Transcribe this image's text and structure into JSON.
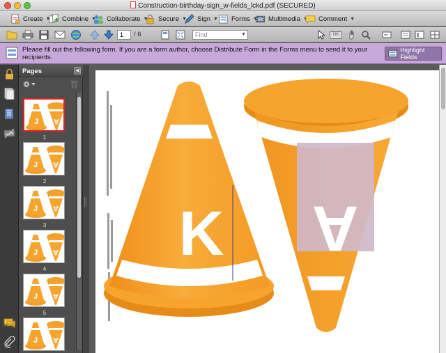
{
  "window": {
    "title": "Construction-birthday-sign_w-fields_lckd.pdf (SECURED)"
  },
  "command_bar": {
    "items": [
      {
        "label": "Create",
        "icon": "create-icon"
      },
      {
        "label": "Combine",
        "icon": "combine-icon"
      },
      {
        "label": "Collaborate",
        "icon": "collaborate-icon"
      },
      {
        "label": "Secure",
        "icon": "lock-icon"
      },
      {
        "label": "Sign",
        "icon": "pen-icon"
      },
      {
        "label": "Forms",
        "icon": "forms-icon"
      },
      {
        "label": "Multimedia",
        "icon": "film-icon"
      },
      {
        "label": "Comment",
        "icon": "comment-icon"
      }
    ]
  },
  "toolbar": {
    "current_page": "1",
    "total_pages": "/ 6",
    "find_placeholder": "Find",
    "ocr_label": "OK"
  },
  "form_notice": {
    "message": "Please fill out the following form. If you are a form author, choose Distribute Form in the Forms menu to send it to your recipients.",
    "highlight_label": "Highlight Fields"
  },
  "pages_panel": {
    "title": "Pages",
    "thumbnails": [
      {
        "number": "1",
        "selected": true
      },
      {
        "number": "2",
        "selected": false
      },
      {
        "number": "3",
        "selected": false
      },
      {
        "number": "4",
        "selected": false
      },
      {
        "number": "5",
        "selected": false
      },
      {
        "number": "",
        "selected": false
      }
    ]
  },
  "document": {
    "left_letter": "K",
    "right_letter": "A",
    "thumb_letter_left": "J",
    "thumb_letter_right": "A"
  },
  "colors": {
    "cone_orange": "#f7a530",
    "cone_dark": "#e58a17",
    "form_bar": "#c7a8d9",
    "field_highlight": "#cfb8c9"
  }
}
